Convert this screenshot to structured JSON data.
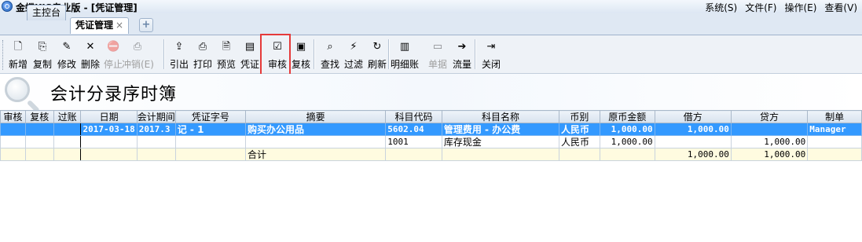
{
  "window": {
    "title": "金蝶KIS专业版 - [凭证管理]",
    "menu": [
      "系统(S)",
      "文件(F)",
      "操作(E)",
      "查看(V)"
    ]
  },
  "tabs": [
    {
      "label": "主控台"
    },
    {
      "label": "凭证管理",
      "close": "×",
      "active": true
    }
  ],
  "tab_add": "+",
  "toolbar": {
    "buttons": [
      {
        "label": "新增",
        "icon": "new-doc-icon",
        "glyph": "🗋"
      },
      {
        "label": "复制",
        "icon": "copy-icon",
        "glyph": "⎘"
      },
      {
        "label": "修改",
        "icon": "edit-icon",
        "glyph": "✎"
      },
      {
        "label": "删除",
        "icon": "delete-icon",
        "glyph": "✕"
      },
      {
        "label": "停止",
        "icon": "stop-icon",
        "glyph": "⛔",
        "disabled": true
      },
      {
        "label": "冲销(E)",
        "icon": "reverse-icon",
        "glyph": "⎙",
        "disabled": true
      },
      {
        "label": "引出",
        "icon": "export-icon",
        "glyph": "⇪"
      },
      {
        "label": "打印",
        "icon": "print-icon",
        "glyph": "⎙"
      },
      {
        "label": "预览",
        "icon": "preview-icon",
        "glyph": "🗎"
      },
      {
        "label": "凭证",
        "icon": "voucher-icon",
        "glyph": "▤"
      },
      {
        "label": "审核",
        "icon": "audit-icon",
        "glyph": "☑"
      },
      {
        "label": "复核",
        "icon": "recheck-icon",
        "glyph": "▣"
      },
      {
        "label": "查找",
        "icon": "find-icon",
        "glyph": "⌕"
      },
      {
        "label": "过滤",
        "icon": "filter-icon",
        "glyph": "⚡"
      },
      {
        "label": "刷新",
        "icon": "refresh-icon",
        "glyph": "↻"
      },
      {
        "label": "明细账",
        "icon": "ledger-icon",
        "glyph": "▥"
      },
      {
        "label": "单据",
        "icon": "document-icon",
        "glyph": "▭",
        "disabled": true
      },
      {
        "label": "流量",
        "icon": "flow-icon",
        "glyph": "➔"
      },
      {
        "label": "关闭",
        "icon": "exit-icon",
        "glyph": "⇥"
      }
    ]
  },
  "report": {
    "title": "会计分录序时簿"
  },
  "grid": {
    "columns": [
      "审核",
      "复核",
      "过账",
      "日期",
      "会计期间",
      "凭证字号",
      "摘要",
      "科目代码",
      "科目名称",
      "币别",
      "原币金额",
      "借方",
      "贷方",
      "制单"
    ],
    "rows": [
      {
        "audit": "",
        "recheck": "",
        "posted": "",
        "date": "2017-03-18",
        "period": "2017.3",
        "voucher_no": "记 - 1",
        "summary": "购买办公用品",
        "account_code": "5602.04",
        "account_name": "管理费用 - 办公费",
        "currency": "人民币",
        "orig_amount": "1,000.00",
        "debit": "1,000.00",
        "credit": "",
        "preparer": "Manager"
      },
      {
        "audit": "",
        "recheck": "",
        "posted": "",
        "date": "",
        "period": "",
        "voucher_no": "",
        "summary": "",
        "account_code": "1001",
        "account_name": "库存现金",
        "currency": "人民币",
        "orig_amount": "1,000.00",
        "debit": "",
        "credit": "1,000.00",
        "preparer": ""
      },
      {
        "audit": "",
        "recheck": "",
        "posted": "",
        "date": "",
        "period": "",
        "voucher_no": "",
        "summary": "合计",
        "account_code": "",
        "account_name": "",
        "currency": "",
        "orig_amount": "",
        "debit": "1,000.00",
        "credit": "1,000.00",
        "preparer": ""
      }
    ]
  },
  "colors": {
    "selected_row": "#3399ff",
    "highlight_box": "#e53a3a",
    "total_row": "#fffbe0"
  }
}
